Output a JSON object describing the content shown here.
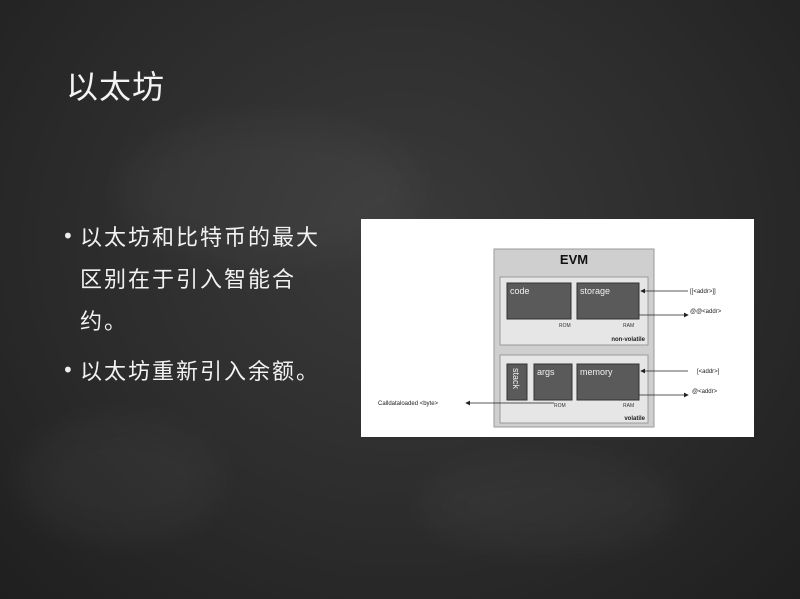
{
  "slide": {
    "title": "以太坊",
    "bullets": [
      {
        "text": "以太坊和比特币的最大区别在于引入智能合约。"
      },
      {
        "text": "以太坊重新引入余额。"
      }
    ]
  },
  "diagram": {
    "title": "EVM",
    "nonvolatile": {
      "label": "non-volatile",
      "code": "code",
      "storage": "storage",
      "rom": "ROM",
      "ram": "RAM",
      "arrow_in": "[[<addr>]]",
      "arrow_out": "@@<addr>"
    },
    "volatile": {
      "label": "volatile",
      "stack": "stack",
      "args": "args",
      "memory": "memory",
      "rom": "ROM",
      "ram": "RAM",
      "arrow_in": "[<addr>]",
      "arrow_out": "@<addr>",
      "calldata": "Calldataloaded <byte>"
    }
  }
}
